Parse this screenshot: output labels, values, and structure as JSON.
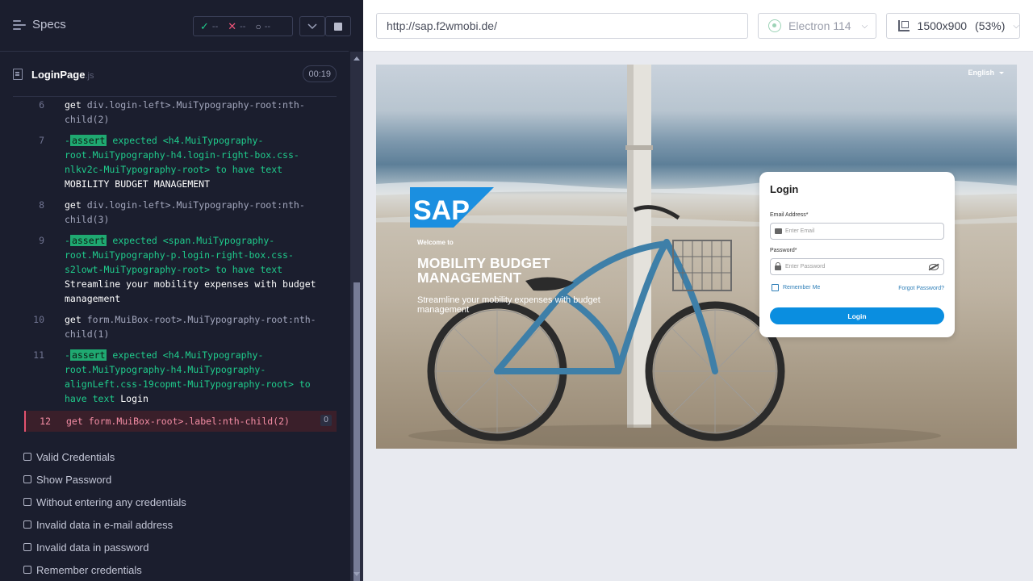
{
  "runner": {
    "specs_label": "Specs",
    "stats": {
      "passed": "--",
      "failed": "--",
      "pending": "--"
    },
    "spec": {
      "name": "LoginPage",
      "ext": ".js",
      "timer": "00:19"
    },
    "commands": [
      {
        "num": "6",
        "type": "get",
        "keyword": "get",
        "selector": "div.login-left>.MuiTypography-root:nth-child(2)"
      },
      {
        "num": "7",
        "type": "assert",
        "dash": "-",
        "tag": "assert",
        "expected": "expected",
        "element": "<h4.MuiTypography-root.MuiTypography-h4.login-right-box.css-nlkv2c-MuiTypography-root>",
        "to_have": "to have text",
        "text": "MOBILITY BUDGET MANAGEMENT"
      },
      {
        "num": "8",
        "type": "get",
        "keyword": "get",
        "selector": "div.login-left>.MuiTypography-root:nth-child(3)"
      },
      {
        "num": "9",
        "type": "assert",
        "dash": "-",
        "tag": "assert",
        "expected": "expected",
        "element": "<span.MuiTypography-root.MuiTypography-p.login-right-box.css-s2lowt-MuiTypography-root>",
        "to_have": "to have text",
        "text": "Streamline your mobility expenses with budget management"
      },
      {
        "num": "10",
        "type": "get",
        "keyword": "get",
        "selector": "form.MuiBox-root>.MuiTypography-root:nth-child(1)"
      },
      {
        "num": "11",
        "type": "assert",
        "dash": "-",
        "tag": "assert",
        "expected": "expected",
        "element": "<h4.MuiTypography-root.MuiTypography-h4.MuiTypography-alignLeft.css-19copmt-MuiTypography-root>",
        "to_have": "to",
        "to_have2": "have text",
        "text": "Login"
      },
      {
        "num": "12",
        "type": "failed",
        "keyword": "get",
        "selector": "form.MuiBox-root>.label:nth-child(2)",
        "badge": "0"
      }
    ],
    "tests": [
      "Valid Credentials",
      "Show Password",
      "Without entering any credentials",
      "Invalid data in e-mail address",
      "Invalid data in password",
      "Remember credentials"
    ]
  },
  "aut": {
    "url": "http://sap.f2wmobi.de/",
    "browser": "Electron 114",
    "viewport": "1500x900",
    "zoom": "(53%)"
  },
  "app": {
    "language": "English",
    "logo_text": "SAP",
    "welcome": "Welcome to",
    "title_line1": "MOBILITY BUDGET",
    "title_line2": "MANAGEMENT",
    "subtitle": "Streamline your mobility expenses with budget management",
    "login": {
      "title": "Login",
      "email_label": "Email Address*",
      "email_placeholder": "Enter Email",
      "password_label": "Password*",
      "password_placeholder": "Enter Password",
      "remember_label": "Remember Me",
      "forgot_label": "Forgot Password?",
      "button_label": "Login"
    }
  }
}
